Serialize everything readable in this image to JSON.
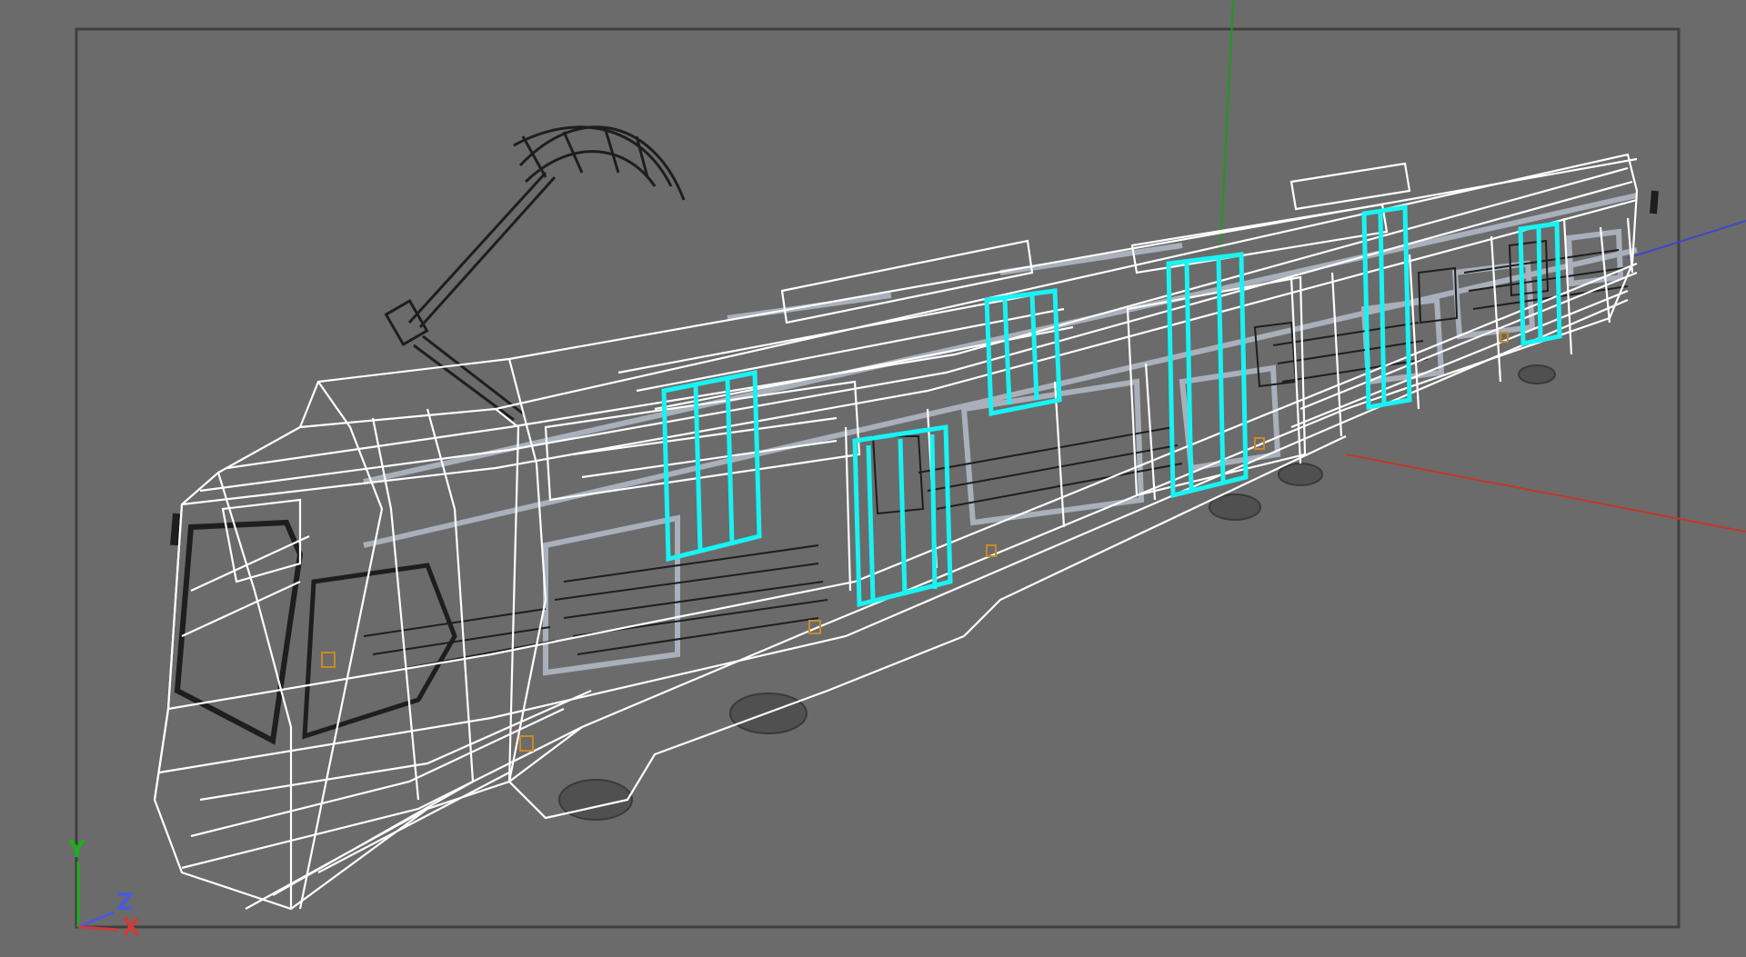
{
  "viewport": {
    "background": "#6b6b6b",
    "frame_color": "#3f3f3f",
    "model": "tram",
    "render_mode": "wireframe",
    "colors": {
      "wire_primary": "#ffffff",
      "wire_secondary": "#a9b0bb",
      "wire_dark": "#1e1e1e",
      "selected": "#18f3f3",
      "marker": "#c78a2a",
      "axis_x": "#c0392b",
      "axis_y": "#1e9a1e",
      "axis_z": "#3b48c9"
    }
  },
  "axis_gizmo": {
    "y_label": "Y",
    "z_label": "Z",
    "x_label": "X",
    "y_color": "#1fae1f",
    "z_color": "#4a5ad8",
    "x_color": "#d23a3a"
  }
}
